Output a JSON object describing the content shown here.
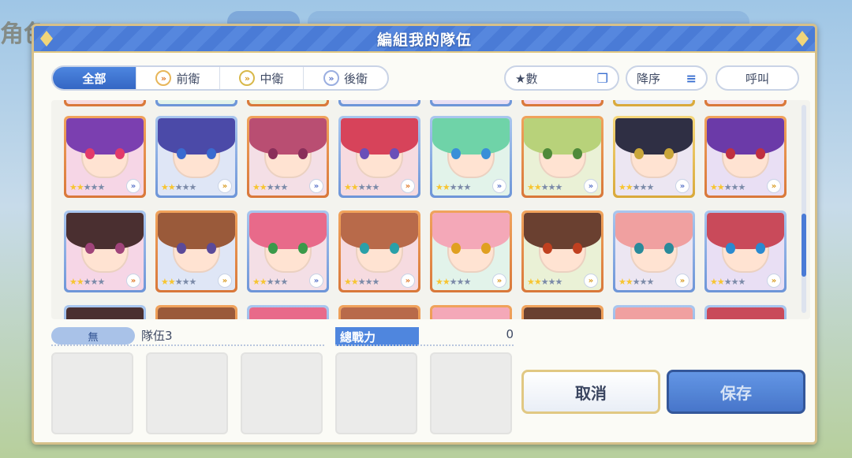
{
  "background": {
    "left_title": "角色"
  },
  "modal": {
    "title": "編組我的隊伍"
  },
  "filter_tabs": [
    {
      "label": "全部",
      "active": true,
      "icon": ""
    },
    {
      "label": "前衛",
      "active": false,
      "icon": "front-position-icon"
    },
    {
      "label": "中衛",
      "active": false,
      "icon": "middle-position-icon"
    },
    {
      "label": "後衛",
      "active": false,
      "icon": "back-position-icon"
    }
  ],
  "controls": {
    "sort_label": "★數",
    "sort_icon": "copy-icon",
    "order_label": "降序",
    "order_icon": "sort-lines-icon",
    "summon_label": "呼叫"
  },
  "characters": [
    {
      "frame": "orange",
      "hair": "#7b3fb0",
      "eye": "#e23a6a",
      "stars": 2,
      "position": "back"
    },
    {
      "frame": "blue",
      "hair": "#4b4aa8",
      "eye": "#3a6ad0",
      "stars": 2,
      "position": "mid"
    },
    {
      "frame": "orange",
      "hair": "#b94e72",
      "eye": "#8a2f5a",
      "stars": 2,
      "position": "back"
    },
    {
      "frame": "blue",
      "hair": "#d7435a",
      "eye": "#6a4fb8",
      "stars": 2,
      "position": "front"
    },
    {
      "frame": "blue",
      "hair": "#6fd3a8",
      "eye": "#3a8fd8",
      "stars": 2,
      "position": "back"
    },
    {
      "frame": "orange",
      "hair": "#b8d27a",
      "eye": "#4f8a3a",
      "stars": 2,
      "position": "back"
    },
    {
      "frame": "gold",
      "hair": "#2f2f44",
      "eye": "#c9a63a",
      "stars": 2,
      "position": "back"
    },
    {
      "frame": "orange",
      "hair": "#6b3aa8",
      "eye": "#c03040",
      "stars": 2,
      "position": "mid"
    },
    {
      "frame": "blue",
      "hair": "#4a2f30",
      "eye": "#a0447a",
      "stars": 2,
      "position": "front"
    },
    {
      "frame": "orange",
      "hair": "#9a5a3a",
      "eye": "#5a4a9a",
      "stars": 2,
      "position": "mid"
    },
    {
      "frame": "blue",
      "hair": "#e86a8a",
      "eye": "#3a9a4a",
      "stars": 2,
      "position": "back"
    },
    {
      "frame": "orange",
      "hair": "#b86a4a",
      "eye": "#2aa0a8",
      "stars": 2,
      "position": "front"
    },
    {
      "frame": "orange",
      "hair": "#f4a8b8",
      "eye": "#e0a020",
      "stars": 2,
      "position": "mid"
    },
    {
      "frame": "orange",
      "hair": "#6a4030",
      "eye": "#c04020",
      "stars": 2,
      "position": "mid"
    },
    {
      "frame": "blue",
      "hair": "#f0a0a0",
      "eye": "#2a8a9a",
      "stars": 2,
      "position": "mid"
    },
    {
      "frame": "blue",
      "hair": "#c94a5a",
      "eye": "#2a8ad0",
      "stars": 2,
      "position": "mid"
    }
  ],
  "team": {
    "badge": "無",
    "name": "隊伍3",
    "power_label": "總戰力",
    "power_value": "0"
  },
  "buttons": {
    "cancel": "取消",
    "save": "保存"
  }
}
